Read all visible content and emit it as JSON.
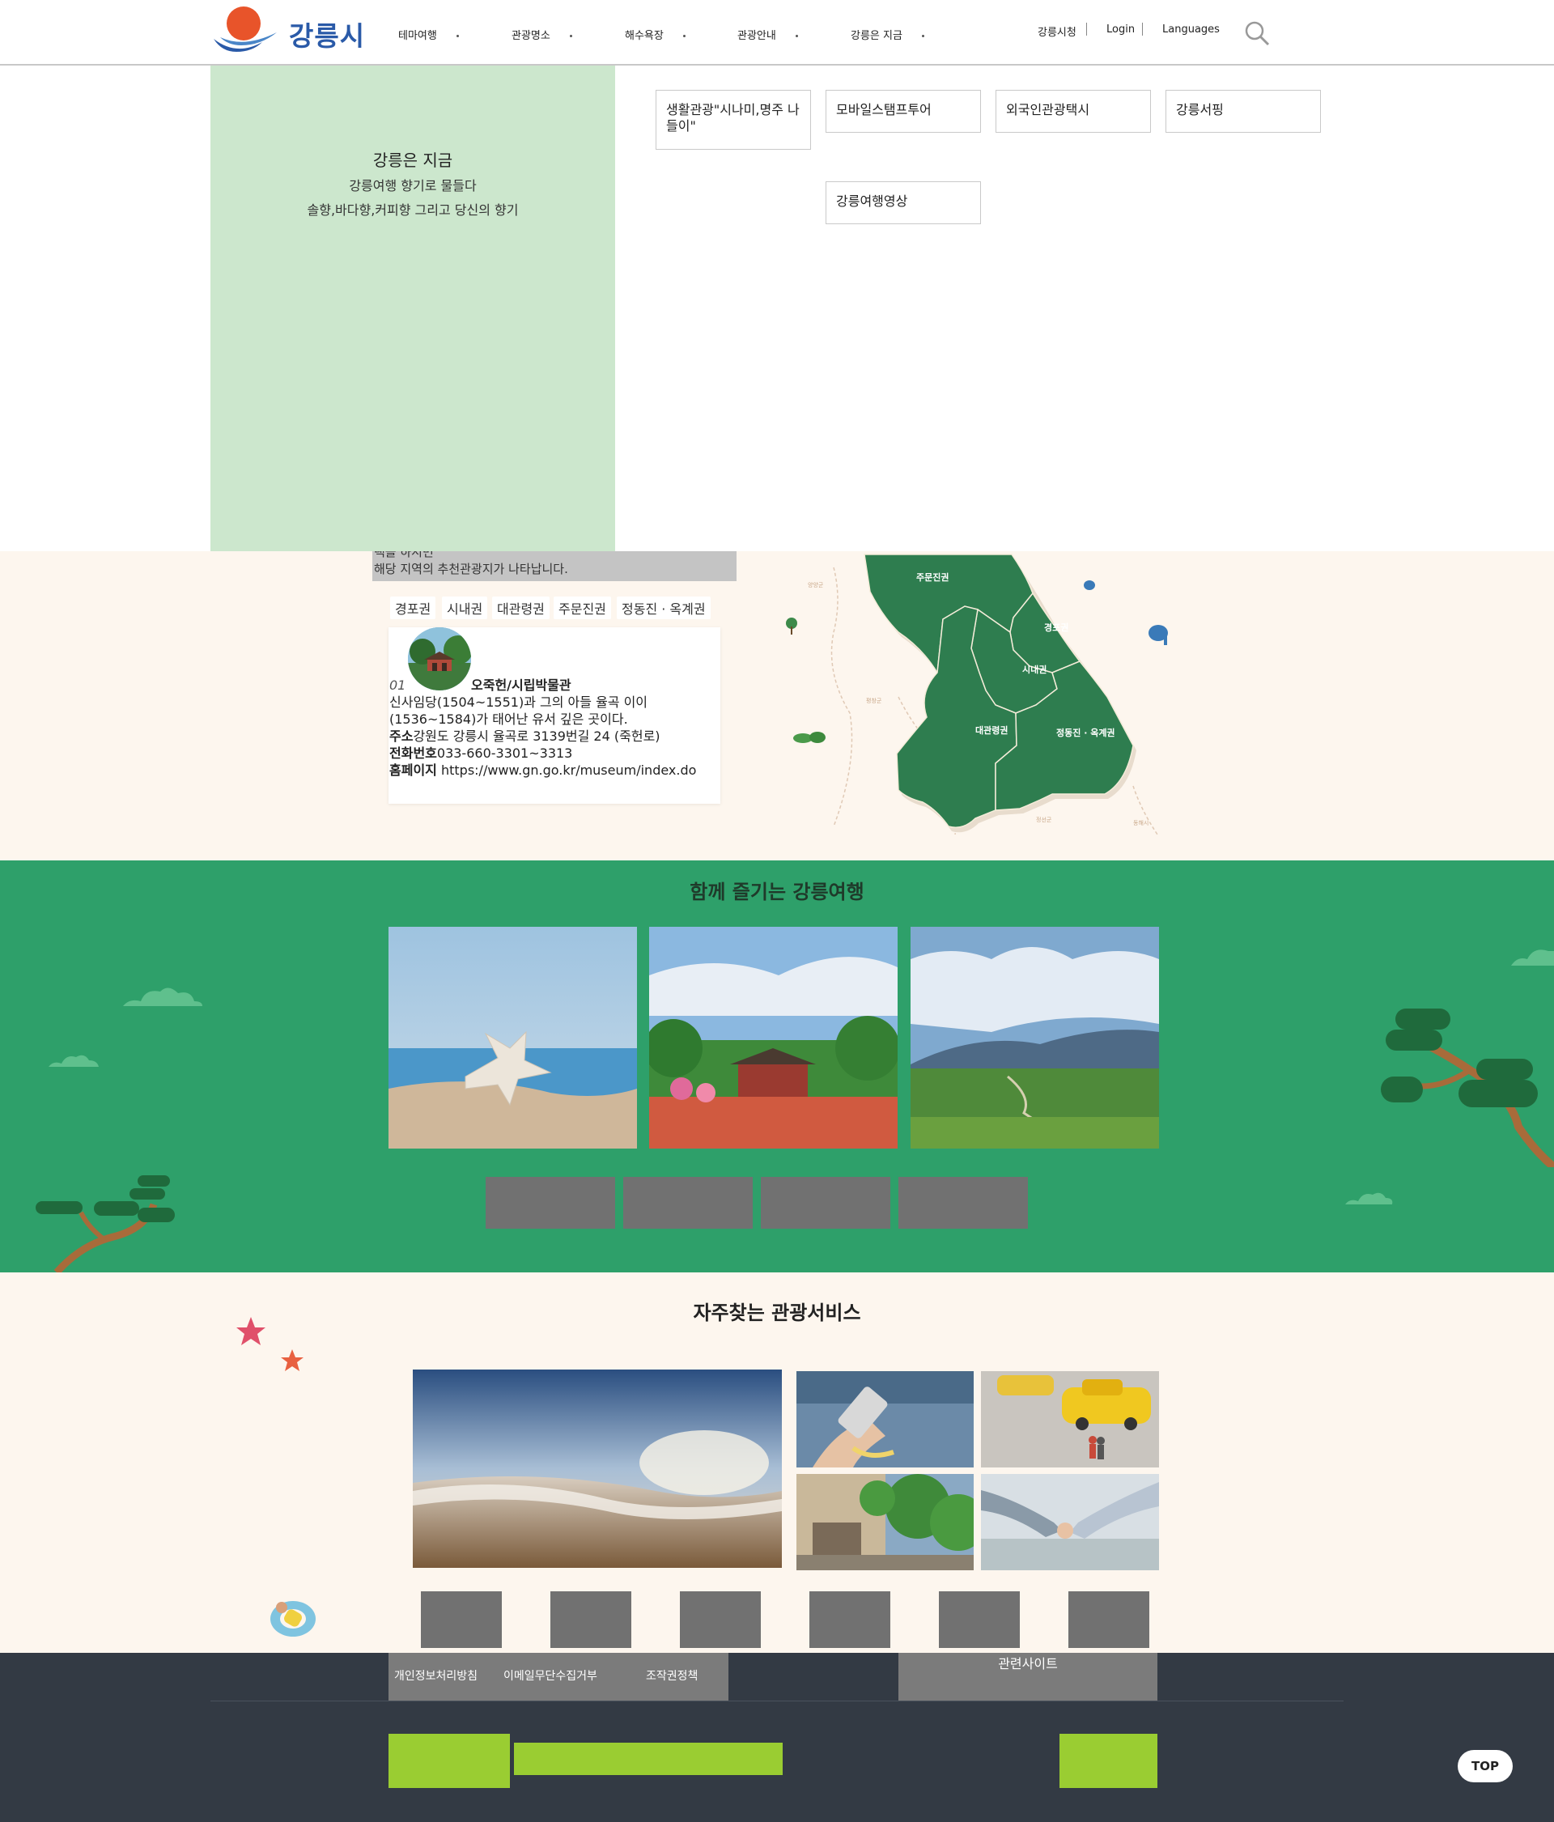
{
  "header": {
    "logo_text": "강릉시",
    "nav": [
      "테마여행",
      "관광명소",
      "해수욕장",
      "관광안내",
      "강릉은 지금"
    ],
    "util": [
      "강릉시청",
      "Login",
      "Languages"
    ]
  },
  "dropdown": {
    "title": "강릉은 지금",
    "sub1": "강릉여행 향기로 물들다",
    "sub2": "솔향,바다향,커피향 그리고 당신의 향기",
    "items": [
      "생활관광\"시나미,명주 나들이\"",
      "모바일스탬프투어",
      "외국인관광택시",
      "강릉서핑",
      "강릉여행영상"
    ]
  },
  "map_section": {
    "note_line1": "택을 하시면",
    "note_line2": "해당 지역의 추천관광지가 나타납니다.",
    "tabs": [
      "경포권",
      "시내권",
      "대관령권",
      "주문진권",
      "정동진 · 옥계권"
    ],
    "card": {
      "number": "01",
      "name": "오죽헌/시립박물관",
      "desc1": "신사임당(1504~1551)과 그의 아들 율곡 이이",
      "desc2": "(1536~1584)가 태어난 유서 깊은 곳이다.",
      "address_label": "주소",
      "address": "강원도 강릉시 율곡로 3139번길 24 (죽헌로)",
      "phone_label": "전화번호",
      "phone": "033-660-3301~3313",
      "homepage_label": "홈페이지",
      "homepage": "https://www.gn.go.kr/museum/index.do"
    },
    "map_labels": [
      "주문진권",
      "경포권",
      "시내권",
      "대관령권",
      "정동진 · 옥계권"
    ],
    "map_minor": [
      "양양군",
      "평창군",
      "정선군",
      "동해시"
    ]
  },
  "green_section": {
    "title": "함께 즐기는 강릉여행"
  },
  "services": {
    "title": "자주찾는 관광서비스"
  },
  "footer": {
    "links": [
      "개인정보처리방침",
      "이메일무단수집거부",
      "조작권정책"
    ],
    "related": "관련사이트",
    "top": "TOP"
  },
  "colors": {
    "map_green": "#2e7d4f",
    "section_green": "#2ea06a",
    "dropdown_green": "#cce7cd",
    "footer_bg": "#333a44",
    "lime": "#9acd32"
  }
}
